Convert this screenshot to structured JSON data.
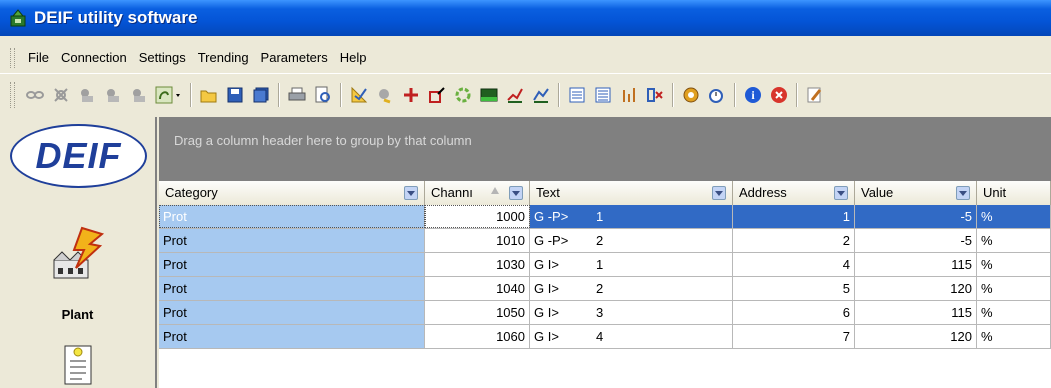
{
  "window": {
    "title": "DEIF utility software"
  },
  "menu": [
    "File",
    "Connection",
    "Settings",
    "Trending",
    "Parameters",
    "Help"
  ],
  "toolbar": {
    "icons": [
      "link-icon",
      "disconnect-icon",
      "read-icon",
      "write-icon",
      "options-dropdown-icon",
      "open-folder-icon",
      "save-icon",
      "save-all-icon",
      "print-icon",
      "print-preview-icon",
      "log-icon",
      "alarm-icon",
      "upload-icon",
      "download-icon",
      "gear-refresh-icon",
      "battery-icon",
      "trend-icon",
      "trend2-icon",
      "list-icon",
      "list2-icon",
      "io-icon",
      "io2-icon",
      "gear-icon",
      "timer-icon",
      "info-icon",
      "stop-icon",
      "wizard-icon"
    ],
    "colors": {
      "info": "#1f5ad6",
      "stop": "#d8342c"
    }
  },
  "left_panel": {
    "logo_text": "DEIF",
    "plant_label": "Plant"
  },
  "grid": {
    "group_hint": "Drag a column header here to group by that column",
    "columns": {
      "category": "Category",
      "channel": "Channı",
      "text": "Text",
      "address": "Address",
      "value": "Value",
      "unit": "Unit"
    },
    "rows": [
      {
        "category": "Prot",
        "channel": "1000",
        "text_a": "G -P>",
        "text_b": "1",
        "address": "1",
        "value": "-5",
        "unit": "%",
        "selected": true
      },
      {
        "category": "Prot",
        "channel": "1010",
        "text_a": "G -P>",
        "text_b": "2",
        "address": "2",
        "value": "-5",
        "unit": "%"
      },
      {
        "category": "Prot",
        "channel": "1030",
        "text_a": "G I>",
        "text_b": "1",
        "address": "4",
        "value": "115",
        "unit": "%"
      },
      {
        "category": "Prot",
        "channel": "1040",
        "text_a": "G I>",
        "text_b": "2",
        "address": "5",
        "value": "120",
        "unit": "%"
      },
      {
        "category": "Prot",
        "channel": "1050",
        "text_a": "G I>",
        "text_b": "3",
        "address": "6",
        "value": "115",
        "unit": "%"
      },
      {
        "category": "Prot",
        "channel": "1060",
        "text_a": "G I>",
        "text_b": "4",
        "address": "7",
        "value": "120",
        "unit": "%"
      }
    ]
  },
  "colors": {
    "titlebar": "#0454d6",
    "selection": "#316ac5",
    "category_cell": "#a6c9f0",
    "group_area": "#808080"
  }
}
